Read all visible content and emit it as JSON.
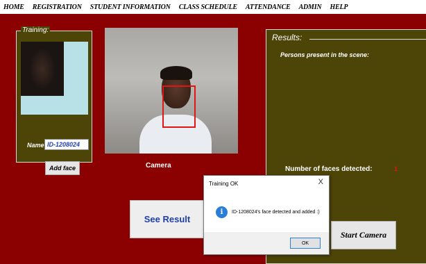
{
  "menu": {
    "items": [
      "HOME",
      "REGISTRATION",
      "STUDENT INFORMATION",
      "CLASS SCHEDULE",
      "ATTENDANCE",
      "ADMIN",
      "HELP"
    ]
  },
  "training": {
    "legend": "Training:",
    "name_label": "Name:",
    "name_value": "ID-1208024",
    "add_face_label": "Add face"
  },
  "camera": {
    "label": "Camera"
  },
  "results": {
    "title": "Results:",
    "persons_label": "Persons present in the scene:",
    "faces_detected_label": "Number of faces detected:",
    "faces_detected_count": "1",
    "start_camera_label": "Start Camera"
  },
  "see_result_label": "See  Result",
  "dialog": {
    "title": "Training OK",
    "close_glyph": "X",
    "icon_glyph": "i",
    "message": "ID-1208024's face detected and added :)",
    "ok_label": "OK"
  },
  "colors": {
    "background": "#8b0000",
    "panel": "#4d4408",
    "accent_red": "#e01616",
    "link_blue": "#1f3fa8"
  }
}
